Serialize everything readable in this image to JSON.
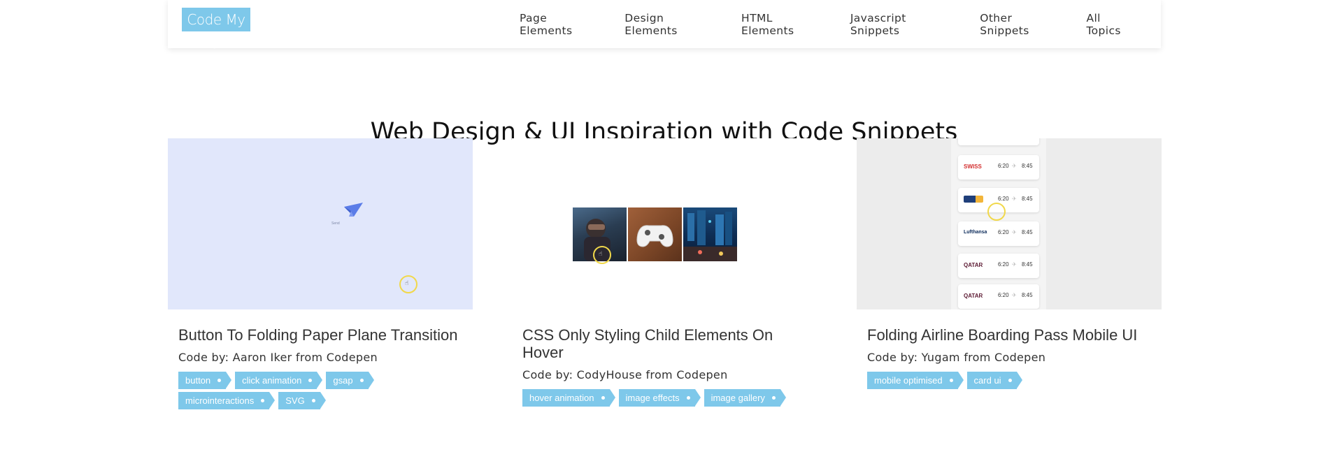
{
  "header": {
    "logo_text": "Code My UI",
    "nav": [
      "Page Elements",
      "Design Elements",
      "HTML Elements",
      "Javascript Snippets",
      "Other Snippets",
      "All Topics"
    ]
  },
  "page_title": "Web Design & UI Inspiration with Code Snippets",
  "cards": [
    {
      "title": "Button To Folding Paper Plane Transition",
      "author": "Code by: Aaron Iker from Codepen",
      "thumb_text": "Send",
      "tags": [
        "button",
        "click animation",
        "gsap",
        "microinteractions",
        "SVG"
      ]
    },
    {
      "title": "CSS Only Styling Child Elements On Hover",
      "author": "Code by: CodyHouse from Codepen",
      "tags": [
        "hover animation",
        "image effects",
        "image gallery"
      ]
    },
    {
      "title": "Folding Airline Boarding Pass Mobile UI",
      "author": "Code by: Yugam from Codepen",
      "tags": [
        "mobile optimised",
        "card ui"
      ],
      "flights": [
        {
          "airline": "SWISS",
          "dep": "6:20",
          "arr": "8:45"
        },
        {
          "airline": "",
          "dep": "6:20",
          "arr": "8:45"
        },
        {
          "airline": "Lufthansa",
          "dep": "6:20",
          "arr": "8:45"
        },
        {
          "airline": "QATAR",
          "dep": "6:20",
          "arr": "8:45"
        },
        {
          "airline": "QATAR",
          "dep": "6:20",
          "arr": "8:45"
        }
      ]
    }
  ],
  "colors": {
    "accent": "#7ec8ea",
    "thumb1_bg": "#e1e7fb",
    "thumb3_bg": "#ececec",
    "plane": "#5b7de8",
    "cursor_ring": "#f1d84a"
  }
}
